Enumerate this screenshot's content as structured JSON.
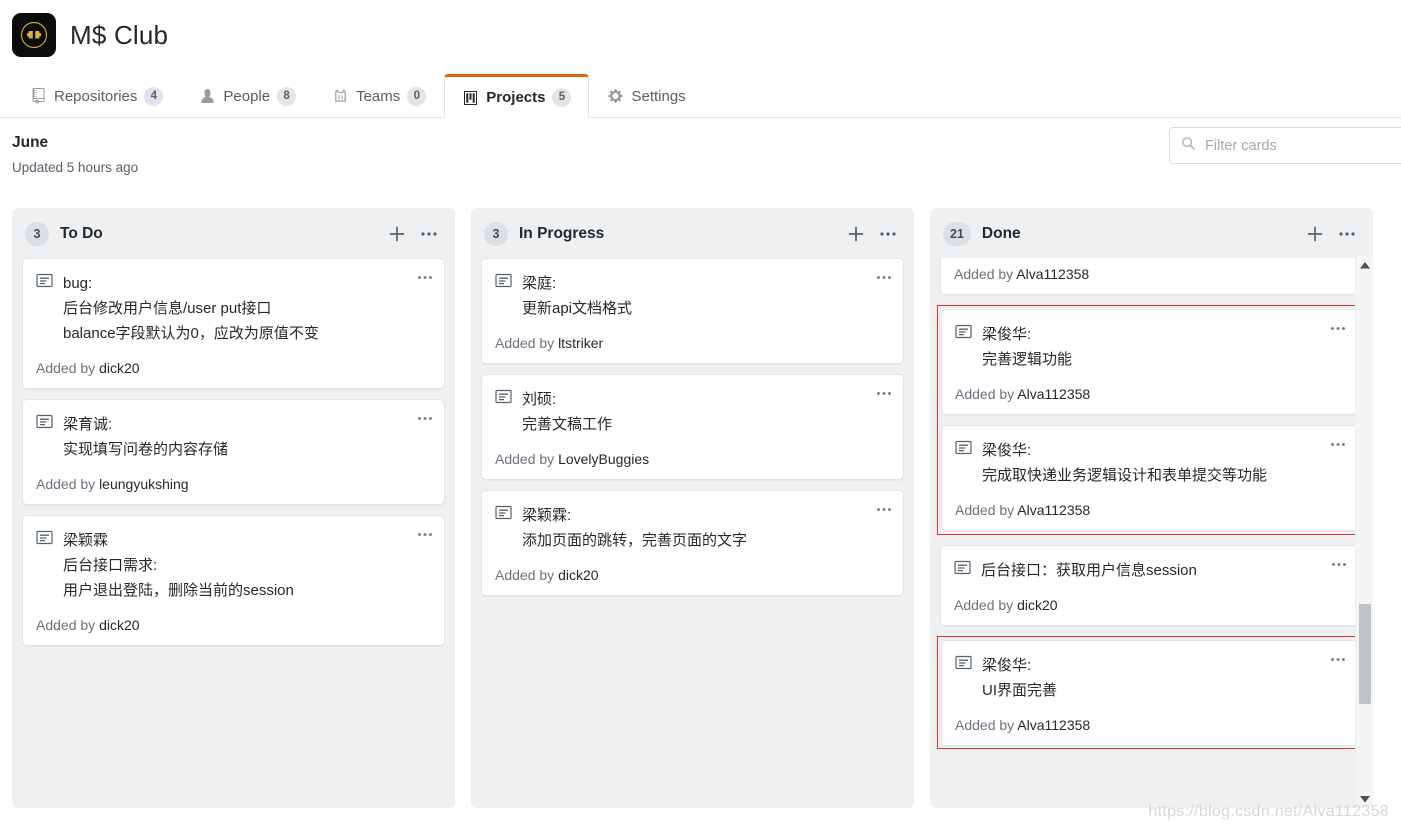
{
  "org": {
    "name": "M$ Club",
    "avatar_icon": "club-emblem-logo"
  },
  "tabs": [
    {
      "id": "repositories",
      "label": "Repositories",
      "count": "4",
      "icon": "repo-icon",
      "active": false
    },
    {
      "id": "people",
      "label": "People",
      "count": "8",
      "icon": "person-icon",
      "active": false
    },
    {
      "id": "teams",
      "label": "Teams",
      "count": "0",
      "icon": "team-jersey-icon",
      "active": false
    },
    {
      "id": "projects",
      "label": "Projects",
      "count": "5",
      "icon": "project-board-icon",
      "active": true
    },
    {
      "id": "settings",
      "label": "Settings",
      "count": "",
      "icon": "gear-icon",
      "active": false
    }
  ],
  "project": {
    "name": "June",
    "updated": "Updated 5 hours ago"
  },
  "search": {
    "placeholder": "Filter cards",
    "value": "",
    "icon": "search-icon"
  },
  "colors": {
    "accent": "#e36209",
    "highlight": "#e83030",
    "column_bg": "#eef0f1",
    "card_bg": "#ffffff"
  },
  "board": {
    "add_icon": "plus-icon",
    "menu_icon": "kebab-horizontal-icon",
    "columns": [
      {
        "id": "todo",
        "title": "To Do",
        "count": "3",
        "cards": [
          {
            "text": "bug:\n后台修改用户信息/user put接口\nbalance字段默认为0，应改为原值不变",
            "added_prefix": "Added by ",
            "added_by": "dick20",
            "highlighted": false
          },
          {
            "text": "梁育诚:\n实现填写问卷的内容存储",
            "added_prefix": "Added by ",
            "added_by": "leungyukshing",
            "highlighted": false
          },
          {
            "text": "梁颖霖\n后台接口需求:\n用户退出登陆，删除当前的session",
            "added_prefix": "Added by ",
            "added_by": "dick20",
            "highlighted": false
          }
        ]
      },
      {
        "id": "in-progress",
        "title": "In Progress",
        "count": "3",
        "cards": [
          {
            "text": "梁庭:\n更新api文档格式",
            "added_prefix": "Added by ",
            "added_by": "ltstriker",
            "highlighted": false
          },
          {
            "text": "刘硕:\n完善文稿工作",
            "added_prefix": "Added by ",
            "added_by": "LovelyBuggies",
            "highlighted": false
          },
          {
            "text": "梁颖霖:\n添加页面的跳转，完善页面的文字",
            "added_prefix": "Added by ",
            "added_by": "dick20",
            "highlighted": false
          }
        ]
      },
      {
        "id": "done",
        "title": "Done",
        "count": "21",
        "cards": [
          {
            "partial": true,
            "text": "",
            "added_prefix": "Added by ",
            "added_by": "Alva112358",
            "highlighted": false
          },
          {
            "text": "梁俊华:\n完善逻辑功能",
            "added_prefix": "Added by ",
            "added_by": "Alva112358",
            "highlighted": true,
            "group": "g1"
          },
          {
            "text": "梁俊华:\n完成取快递业务逻辑设计和表单提交等功能",
            "added_prefix": "Added by ",
            "added_by": "Alva112358",
            "highlighted": true,
            "group": "g1"
          },
          {
            "text": "后台接口：获取用户信息session",
            "added_prefix": "Added by ",
            "added_by": "dick20",
            "highlighted": false
          },
          {
            "text": "梁俊华:\nUI界面完善",
            "added_prefix": "Added by ",
            "added_by": "Alva112358",
            "highlighted": true,
            "group": "g2",
            "clipped": true
          }
        ]
      }
    ]
  },
  "watermark": "https://blog.csdn.net/Alva112358"
}
